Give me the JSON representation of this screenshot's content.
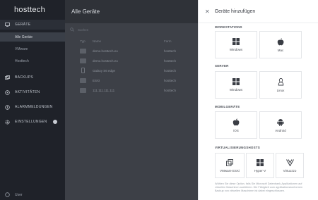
{
  "sidebar": {
    "logo": "hosttech",
    "items": [
      {
        "label": "GERÄTE",
        "icon": "monitor-icon"
      },
      {
        "label": "Alle Geräte"
      },
      {
        "label": "VMware"
      },
      {
        "label": "Hosttech"
      },
      {
        "label": "BACKUPS",
        "icon": "backup-icon"
      },
      {
        "label": "AKTIVITÄTEN",
        "icon": "activity-icon"
      },
      {
        "label": "ALARMMELDUNGEN",
        "icon": "alert-icon"
      },
      {
        "label": "EINSTELLUNGEN",
        "icon": "gear-icon"
      }
    ],
    "user": "User"
  },
  "main": {
    "title": "Alle Geräte",
    "search_placeholder": "Suchen",
    "columns": [
      "Typ",
      "Name",
      "Farm"
    ],
    "rows": [
      {
        "name": "demo.hosttech.eu",
        "farm": "hosttech"
      },
      {
        "name": "demo.hosttech.eu",
        "farm": "hosttech"
      },
      {
        "name": "Galaxy S6 edge",
        "farm": "hosttech"
      },
      {
        "name": "ESXI",
        "farm": "hosttech"
      },
      {
        "name": "111.111.111.111",
        "farm": "hosttech"
      }
    ]
  },
  "panel": {
    "title": "Geräte hinzufügen",
    "sections": [
      {
        "title": "WORKSTATIONS",
        "tiles": [
          "Windows",
          "Mac"
        ]
      },
      {
        "title": "SERVER",
        "tiles": [
          "Windows",
          "Linux"
        ]
      },
      {
        "title": "MOBILGERÄTE",
        "tiles": [
          "iOS",
          "Android"
        ]
      },
      {
        "title": "VIRTUALISIERUNGSHOSTS",
        "tiles": [
          "VMware ESXi",
          "Hyper-V",
          "Virtuozzo"
        ]
      }
    ],
    "note": "Wählen Sie diese Option, falls Sie Microsoft Datenbank-Applikationen auf virtuellen Maschinen ausführen. Die Fähigkeit zum applikationskonformen Backup von virtuellen Maschinen ist dabei eingeschlossen."
  }
}
